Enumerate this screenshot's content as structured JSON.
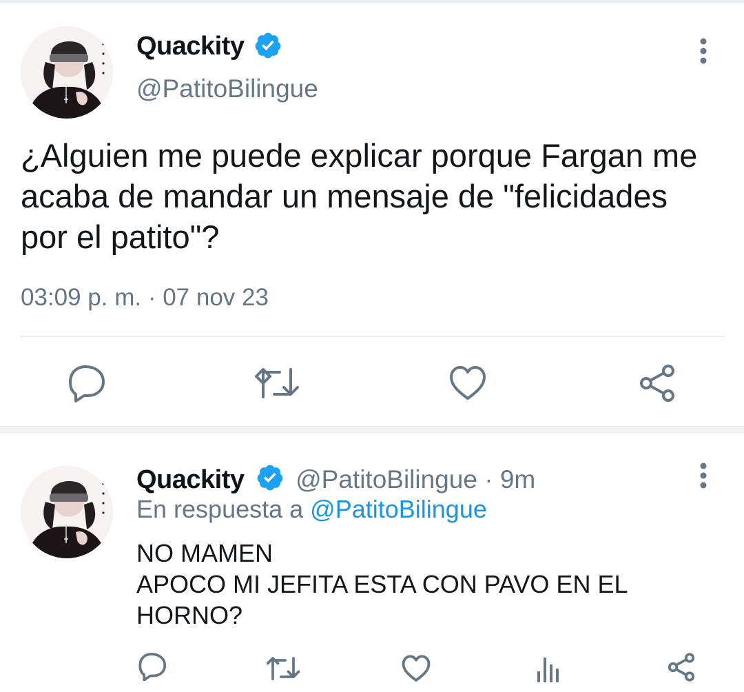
{
  "main_tweet": {
    "author_name": "Quackity",
    "handle": "@PatitoBilingue",
    "text_lines": [
      "¿Alguien me puede explicar porque Fargan me",
      "acaba de mandar un mensaje de \"felicidades",
      "por el patito\"?"
    ],
    "timestamp": "03:09 p. m. · 07 nov 23"
  },
  "reply_tweet": {
    "author_name": "Quackity",
    "handle": "@PatitoBilingue",
    "separator": "·",
    "time": "9m",
    "in_reply_prefix": "En respuesta a",
    "in_reply_handle": "@PatitoBilingue",
    "text_lines": [
      "NO MAMEN",
      "APOCO MI JEFITA ESTA CON PAVO EN EL",
      "HORNO?"
    ]
  },
  "icons": {
    "verified": "verified-badge-icon",
    "more": "more-vertical-icon",
    "reply": "reply-icon",
    "retweet": "retweet-icon",
    "like": "like-icon",
    "analytics": "analytics-icon",
    "share": "share-icon"
  },
  "colors": {
    "verified": "#1da1f2",
    "link": "#1b95e0",
    "muted": "#657786",
    "icon": "#657786",
    "text": "#14171a"
  }
}
